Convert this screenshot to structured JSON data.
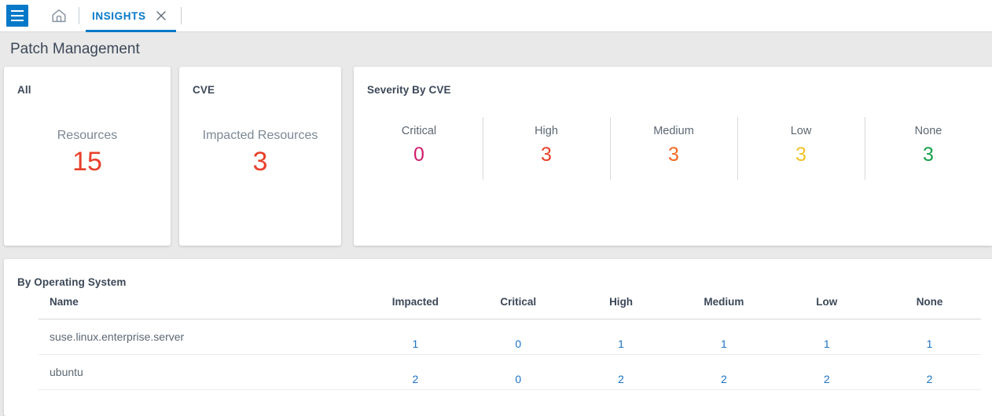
{
  "topbar": {
    "menu_icon": "hamburger-menu-icon",
    "home_icon": "home-icon",
    "tab_label": "INSIGHTS",
    "tab_close_icon": "close-icon"
  },
  "header": {
    "title": "Patch Management"
  },
  "colors": {
    "accent_blue": "#0579c8",
    "link_blue": "#1b73c4",
    "red": "#e8402a",
    "critical": "#d01c6b",
    "high": "#e8402a",
    "medium": "#f26722",
    "low": "#f2c327",
    "none": "#19a04b",
    "page_bg": "#e9e9e9"
  },
  "cards": {
    "all": {
      "title": "All",
      "kpi_label": "Resources",
      "kpi_value": "15"
    },
    "cve": {
      "title": "CVE",
      "kpi_label": "Impacted Resources",
      "kpi_value": "3"
    },
    "severity": {
      "title": "Severity By CVE",
      "items": [
        {
          "label": "Critical",
          "value": "0",
          "color": "#d01c6b"
        },
        {
          "label": "High",
          "value": "3",
          "color": "#e8402a"
        },
        {
          "label": "Medium",
          "value": "3",
          "color": "#f26722"
        },
        {
          "label": "Low",
          "value": "3",
          "color": "#f2c327"
        },
        {
          "label": "None",
          "value": "3",
          "color": "#19a04b"
        }
      ]
    }
  },
  "os_table": {
    "title": "By Operating System",
    "columns": [
      "Name",
      "Impacted",
      "Critical",
      "High",
      "Medium",
      "Low",
      "None"
    ],
    "rows": [
      {
        "name": "suse.linux.enterprise.server",
        "impacted": "1",
        "critical": "0",
        "high": "1",
        "medium": "1",
        "low": "1",
        "none": "1"
      },
      {
        "name": "ubuntu",
        "impacted": "2",
        "critical": "0",
        "high": "2",
        "medium": "2",
        "low": "2",
        "none": "2"
      }
    ]
  }
}
